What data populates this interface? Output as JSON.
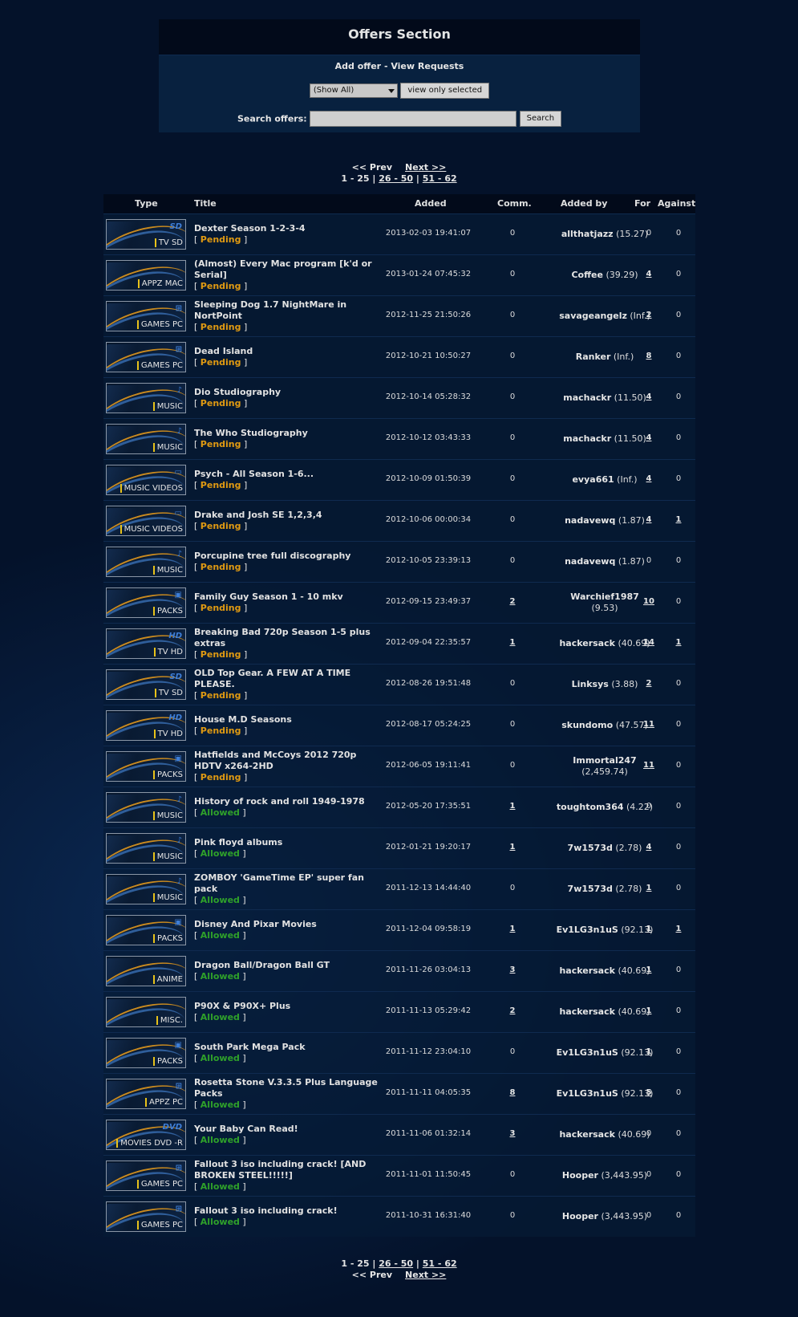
{
  "panel": {
    "title": "Offers Section",
    "add_offer": "Add offer",
    "separator": " - ",
    "view_requests": "View Requests",
    "filter_selected": "(Show All)",
    "view_selected_button": "view only selected",
    "search_label": "Search offers:",
    "search_placeholder": "",
    "search_button": "Search"
  },
  "pager": {
    "prev": "<< Prev",
    "next": "Next >>",
    "current": "1 - 25",
    "pages": [
      "26 - 50",
      "51 - 62"
    ],
    "sep": " | "
  },
  "columns": {
    "type": "Type",
    "title": "Title",
    "added": "Added",
    "comm": "Comm.",
    "added_by": "Added by",
    "for": "For",
    "against": "Against"
  },
  "colors": {
    "pending": "#e09a12",
    "allowed": "#2fa12a",
    "accent": "#e8c21a"
  },
  "rows": [
    {
      "type": "TV SD",
      "icon": "SD",
      "title": "Dexter Season 1-2-3-4",
      "status": "Pending",
      "added": "2013-02-03 19:41:07",
      "comm": "0",
      "user": "allthatjazz",
      "ratio": "(15.27)",
      "for": "0",
      "against": "0"
    },
    {
      "type": "APPZ MAC",
      "icon": "",
      "title": "(Almost) Every Mac program [k'd or Serial]",
      "status": "Pending",
      "added": "2013-01-24 07:45:32",
      "comm": "0",
      "user": "Coffee",
      "ratio": "(39.29)",
      "for": "4",
      "against": "0"
    },
    {
      "type": "GAMES PC",
      "icon": "⊞",
      "title": "Sleeping Dog 1.7 NightMare in NortPoint",
      "status": "Pending",
      "added": "2012-11-25 21:50:26",
      "comm": "0",
      "user": "savageangelz",
      "ratio": "(Inf.)",
      "for": "2",
      "against": "0"
    },
    {
      "type": "GAMES PC",
      "icon": "⊞",
      "title": "Dead Island",
      "status": "Pending",
      "added": "2012-10-21 10:50:27",
      "comm": "0",
      "user": "Ranker",
      "ratio": "(Inf.)",
      "for": "8",
      "against": "0"
    },
    {
      "type": "MUSIC",
      "icon": "♪",
      "title": "Dio Studiography",
      "status": "Pending",
      "added": "2012-10-14 05:28:32",
      "comm": "0",
      "user": "machackr",
      "ratio": "(11.50)",
      "for": "4",
      "against": "0"
    },
    {
      "type": "MUSIC",
      "icon": "♪",
      "title": "The Who Studiography",
      "status": "Pending",
      "added": "2012-10-12 03:43:33",
      "comm": "0",
      "user": "machackr",
      "ratio": "(11.50)",
      "for": "4",
      "against": "0"
    },
    {
      "type": "MUSIC VIDEOS",
      "icon": "▭",
      "title": "Psych - All Season 1-6...",
      "status": "Pending",
      "added": "2012-10-09 01:50:39",
      "comm": "0",
      "user": "evya661",
      "ratio": "(Inf.)",
      "for": "4",
      "against": "0"
    },
    {
      "type": "MUSIC VIDEOS",
      "icon": "▭",
      "title": "Drake and Josh SE 1,2,3,4",
      "status": "Pending",
      "added": "2012-10-06 00:00:34",
      "comm": "0",
      "user": "nadavewq",
      "ratio": "(1.87)",
      "for": "4",
      "against": "1"
    },
    {
      "type": "MUSIC",
      "icon": "♪",
      "title": "Porcupine tree full discography",
      "status": "Pending",
      "added": "2012-10-05 23:39:13",
      "comm": "0",
      "user": "nadavewq",
      "ratio": "(1.87)",
      "for": "0",
      "against": "0"
    },
    {
      "type": "PACKS",
      "icon": "▣",
      "title": "Family Guy Season 1 - 10 mkv",
      "status": "Pending",
      "added": "2012-09-15 23:49:37",
      "comm": "2",
      "user": "Warchief1987",
      "ratio": "(9.53)",
      "for": "10",
      "against": "0"
    },
    {
      "type": "TV HD",
      "icon": "HD",
      "title": "Breaking Bad 720p Season 1-5 plus extras",
      "status": "Pending",
      "added": "2012-09-04 22:35:57",
      "comm": "1",
      "user": "hackersack",
      "ratio": "(40.69)",
      "for": "14",
      "against": "1"
    },
    {
      "type": "TV SD",
      "icon": "SD",
      "title": "OLD Top Gear. A FEW AT A TIME PLEASE.",
      "status": "Pending",
      "added": "2012-08-26 19:51:48",
      "comm": "0",
      "user": "Linksys",
      "ratio": "(3.88)",
      "for": "2",
      "against": "0"
    },
    {
      "type": "TV HD",
      "icon": "HD",
      "title": "House M.D Seasons",
      "status": "Pending",
      "added": "2012-08-17 05:24:25",
      "comm": "0",
      "user": "skundomo",
      "ratio": "(47.57)",
      "for": "11",
      "against": "0"
    },
    {
      "type": "PACKS",
      "icon": "▣",
      "title": "Hatfields and McCoys 2012 720p HDTV x264-2HD",
      "status": "Pending",
      "added": "2012-06-05 19:11:41",
      "comm": "0",
      "user": "Immortal247",
      "ratio": "(2,459.74)",
      "for": "11",
      "against": "0"
    },
    {
      "type": "MUSIC",
      "icon": "♪",
      "title": "History of rock and roll 1949-1978",
      "status": "Allowed",
      "added": "2012-05-20 17:35:51",
      "comm": "1",
      "user": "toughtom364",
      "ratio": "(4.22)",
      "for": "0",
      "against": "0"
    },
    {
      "type": "MUSIC",
      "icon": "♪",
      "title": "Pink floyd albums",
      "status": "Allowed",
      "added": "2012-01-21 19:20:17",
      "comm": "1",
      "user": "7w1573d",
      "ratio": "(2.78)",
      "for": "4",
      "against": "0"
    },
    {
      "type": "MUSIC",
      "icon": "♪",
      "title": "ZOMBOY 'GameTime EP' super fan pack",
      "status": "Allowed",
      "added": "2011-12-13 14:44:40",
      "comm": "0",
      "user": "7w1573d",
      "ratio": "(2.78)",
      "for": "1",
      "against": "0"
    },
    {
      "type": "PACKS",
      "icon": "▣",
      "title": "Disney And Pixar Movies",
      "status": "Allowed",
      "added": "2011-12-04 09:58:19",
      "comm": "1",
      "user": "Ev1LG3n1uS",
      "ratio": "(92.13)",
      "for": "1",
      "against": "1"
    },
    {
      "type": "ANIME",
      "icon": "",
      "title": "Dragon Ball/Dragon Ball GT",
      "status": "Allowed",
      "added": "2011-11-26 03:04:13",
      "comm": "3",
      "user": "hackersack",
      "ratio": "(40.69)",
      "for": "1",
      "against": "0"
    },
    {
      "type": "MISC.",
      "icon": "",
      "title": "P90X & P90X+ Plus",
      "status": "Allowed",
      "added": "2011-11-13 05:29:42",
      "comm": "2",
      "user": "hackersack",
      "ratio": "(40.69)",
      "for": "1",
      "against": "0"
    },
    {
      "type": "PACKS",
      "icon": "▣",
      "title": "South Park Mega Pack",
      "status": "Allowed",
      "added": "2011-11-12 23:04:10",
      "comm": "0",
      "user": "Ev1LG3n1uS",
      "ratio": "(92.13)",
      "for": "1",
      "against": "0"
    },
    {
      "type": "APPZ PC",
      "icon": "⊞",
      "title": "Rosetta Stone V.3.3.5 Plus Language Packs",
      "status": "Allowed",
      "added": "2011-11-11 04:05:35",
      "comm": "8",
      "user": "Ev1LG3n1uS",
      "ratio": "(92.13)",
      "for": "5",
      "against": "0"
    },
    {
      "type": "MOVIES DVD -R",
      "icon": "DVD",
      "title": "Your Baby Can Read!",
      "status": "Allowed",
      "added": "2011-11-06 01:32:14",
      "comm": "3",
      "user": "hackersack",
      "ratio": "(40.69)",
      "for": "0",
      "against": "0"
    },
    {
      "type": "GAMES PC",
      "icon": "⊞",
      "title": "Fallout 3 iso including crack! [AND BROKEN STEEL!!!!!]",
      "status": "Allowed",
      "added": "2011-11-01 11:50:45",
      "comm": "0",
      "user": "Hooper",
      "ratio": "(3,443.95)",
      "for": "0",
      "against": "0"
    },
    {
      "type": "GAMES PC",
      "icon": "⊞",
      "title": "Fallout 3 iso including crack!",
      "status": "Allowed",
      "added": "2011-10-31 16:31:40",
      "comm": "0",
      "user": "Hooper",
      "ratio": "(3,443.95)",
      "for": "0",
      "against": "0"
    }
  ]
}
